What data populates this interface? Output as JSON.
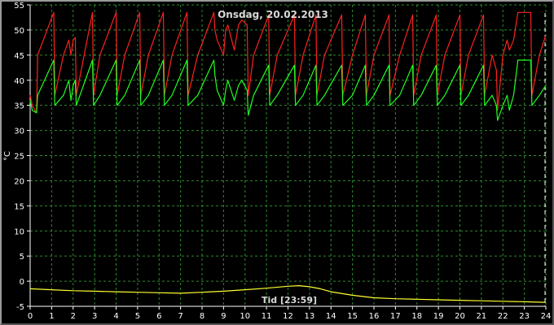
{
  "chart_data": {
    "type": "line",
    "title": "Onsdag, 20.02.2013",
    "xlabel": "Tid [23:59]",
    "ylabel": "°C",
    "xlim": [
      0,
      24
    ],
    "ylim": [
      -5,
      55
    ],
    "xticks": [
      0,
      1,
      2,
      3,
      4,
      5,
      6,
      7,
      8,
      9,
      10,
      11,
      12,
      13,
      14,
      15,
      16,
      17,
      18,
      19,
      20,
      21,
      22,
      23,
      24
    ],
    "yticks": [
      -5,
      0,
      5,
      10,
      15,
      20,
      25,
      30,
      35,
      40,
      45,
      50,
      55
    ],
    "grid": true,
    "series": [
      {
        "color": "#ff2020",
        "x": [
          0,
          0.1,
          0.3,
          0.35,
          1.1,
          1.15,
          1.55,
          1.8,
          1.9,
          2.0,
          2.1,
          2.15,
          2.9,
          2.95,
          3.25,
          4.0,
          4.05,
          4.4,
          5.1,
          5.15,
          5.5,
          6.2,
          6.25,
          6.6,
          7.3,
          7.35,
          7.8,
          8.55,
          8.6,
          8.7,
          9.0,
          9.1,
          9.2,
          9.5,
          9.7,
          9.85,
          10.1,
          10.15,
          10.4,
          11.1,
          11.15,
          11.5,
          12.3,
          12.35,
          12.7,
          13.3,
          13.35,
          13.7,
          14.5,
          14.55,
          15.0,
          15.6,
          15.65,
          16.0,
          16.7,
          16.75,
          17.2,
          17.8,
          17.85,
          18.2,
          18.9,
          18.95,
          19.3,
          20.0,
          20.05,
          20.4,
          21.1,
          21.15,
          21.5,
          21.7,
          21.75,
          22.0,
          22.2,
          22.3,
          22.5,
          22.7,
          23.3,
          23.35,
          23.7,
          24.0
        ],
        "y": [
          37,
          35,
          33.5,
          45,
          53.5,
          37,
          45,
          48,
          45,
          48,
          48.5,
          37,
          53.5,
          37,
          45,
          53.5,
          37,
          45,
          53.5,
          37,
          45,
          53.5,
          37,
          45,
          53.5,
          37,
          45,
          53.5,
          50,
          48,
          45,
          50,
          51,
          46,
          51,
          52,
          51,
          37,
          45,
          53,
          37,
          45,
          53,
          37,
          45,
          53,
          37,
          45,
          53,
          37,
          45,
          53,
          37,
          45,
          53,
          37,
          45,
          53,
          37,
          45,
          53,
          37,
          45,
          53,
          37,
          45,
          53,
          37,
          45,
          42,
          34,
          45,
          48,
          46,
          48,
          53.5,
          53.5,
          37,
          45,
          49
        ]
      },
      {
        "color": "#20ff20",
        "x": [
          0,
          0.1,
          0.3,
          0.35,
          1.1,
          1.15,
          1.55,
          1.8,
          1.9,
          2.0,
          2.1,
          2.15,
          2.9,
          2.95,
          3.25,
          4.0,
          4.05,
          4.4,
          5.1,
          5.15,
          5.5,
          6.2,
          6.25,
          6.6,
          7.3,
          7.35,
          7.8,
          8.55,
          8.6,
          8.7,
          9.0,
          9.1,
          9.2,
          9.5,
          9.7,
          9.85,
          10.1,
          10.15,
          10.4,
          11.1,
          11.15,
          11.5,
          12.3,
          12.35,
          12.7,
          13.3,
          13.35,
          13.7,
          14.5,
          14.55,
          15.0,
          15.6,
          15.65,
          16.0,
          16.7,
          16.75,
          17.2,
          17.8,
          17.85,
          18.2,
          18.9,
          18.95,
          19.3,
          20.0,
          20.05,
          20.4,
          21.1,
          21.15,
          21.5,
          21.7,
          21.75,
          22.0,
          22.2,
          22.3,
          22.5,
          22.7,
          23.3,
          23.35,
          23.7,
          24.0
        ],
        "y": [
          36,
          34,
          33.5,
          37,
          44,
          35,
          37,
          40,
          36,
          39,
          40,
          35,
          44,
          35,
          37,
          44,
          35,
          37,
          44,
          35,
          37,
          44,
          35,
          37,
          44,
          35,
          37,
          44,
          41,
          38,
          35,
          38,
          40,
          36,
          39,
          40,
          38,
          33,
          37,
          43,
          35,
          37,
          43,
          35,
          37,
          43,
          35,
          37,
          43,
          35,
          37,
          43,
          35,
          37,
          43,
          35,
          37,
          43,
          35,
          37,
          43,
          35,
          37,
          43,
          35,
          37,
          43,
          35,
          37,
          35,
          32,
          35,
          37,
          34,
          37,
          44,
          44,
          35,
          37,
          39
        ]
      },
      {
        "color": "#ffff30",
        "x": [
          0,
          1,
          2,
          3,
          4,
          5,
          6,
          7,
          8,
          9,
          10,
          11,
          12,
          12.5,
          13,
          13.5,
          14,
          15,
          16,
          17,
          18,
          19,
          20,
          21,
          22,
          23,
          24
        ],
        "y": [
          -1.5,
          -1.7,
          -1.9,
          -2.0,
          -2.1,
          -2.2,
          -2.3,
          -2.4,
          -2.2,
          -2.0,
          -1.7,
          -1.4,
          -1.0,
          -0.9,
          -1.1,
          -1.5,
          -2.1,
          -2.8,
          -3.3,
          -3.5,
          -3.6,
          -3.7,
          -3.8,
          -3.9,
          -4.0,
          -4.1,
          -4.2
        ]
      }
    ]
  }
}
